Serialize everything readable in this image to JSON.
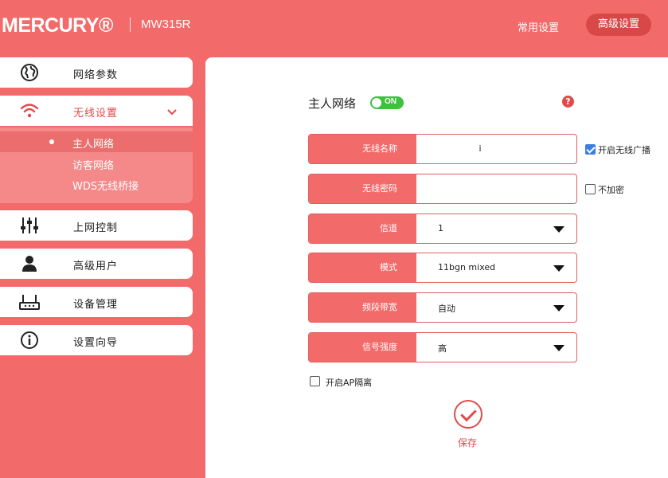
{
  "header": {
    "brand": "MERCURY®",
    "model": "MW315R",
    "nav_common": "常用设置",
    "nav_advanced": "高级设置"
  },
  "sidebar": {
    "items": [
      {
        "label": "网络参数",
        "icon": "globe-icon"
      },
      {
        "label": "无线设置",
        "icon": "wifi-icon",
        "expanded": true
      },
      {
        "label": "上网控制",
        "icon": "sliders-icon"
      },
      {
        "label": "高级用户",
        "icon": "user-icon"
      },
      {
        "label": "设备管理",
        "icon": "router-icon"
      },
      {
        "label": "设置向导",
        "icon": "info-icon"
      }
    ],
    "submenu": [
      {
        "label": "主人网络",
        "selected": true
      },
      {
        "label": "访客网络"
      },
      {
        "label": "WDS无线桥接"
      }
    ]
  },
  "main": {
    "title": "主人网络",
    "toggle_label": "ON",
    "toggle_on": true,
    "help_symbol": "?",
    "fields": {
      "ssid": {
        "label": "无线名称",
        "value": "i"
      },
      "password": {
        "label": "无线密码",
        "value": ""
      },
      "channel": {
        "label": "信道",
        "value": "1"
      },
      "mode": {
        "label": "模式",
        "value": "11bgn mixed"
      },
      "bandwidth": {
        "label": "频段带宽",
        "value": "自动"
      },
      "signal": {
        "label": "信号强度",
        "value": "高"
      }
    },
    "broadcast_label": "开启无线广播",
    "broadcast_checked": true,
    "no_encrypt_label": "不加密",
    "no_encrypt_checked": false,
    "ap_isolation_label": "开启AP隔离",
    "ap_isolation_checked": false,
    "save_label": "保存"
  },
  "colors": {
    "brand_red": "#f26a6a",
    "accent_red": "#e24a4a",
    "toggle_green": "#3ec23e",
    "checkbox_blue": "#3a7fe0"
  }
}
